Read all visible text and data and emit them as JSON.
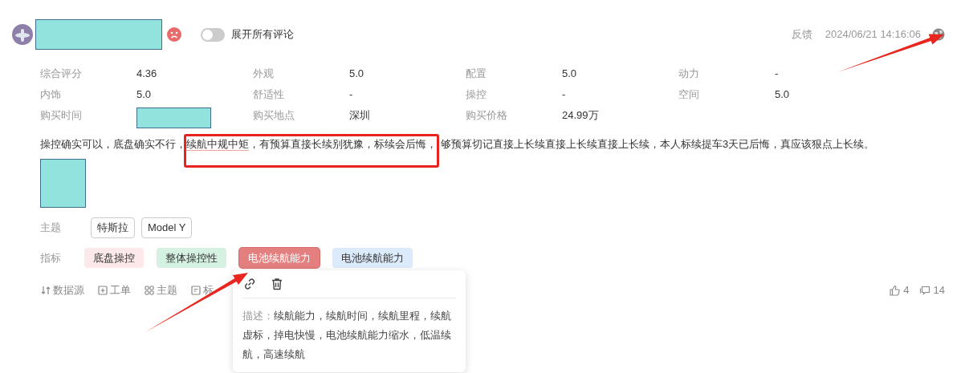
{
  "review": {
    "user": {
      "name_redacted": true
    },
    "sentiment": {
      "kind": "negative"
    },
    "expand_toggle": {
      "label": "展开所有评论",
      "on": false
    },
    "feedback": "反馈",
    "time": "2024/06/21 14:16:06"
  },
  "stats": [
    {
      "label": "综合评分",
      "value": "4.36"
    },
    {
      "label": "外观",
      "value": "5.0"
    },
    {
      "label": "配置",
      "value": "5.0"
    },
    {
      "label": "动力",
      "value": "-"
    },
    {
      "label": "内饰",
      "value": "5.0"
    },
    {
      "label": "舒适性",
      "value": "-"
    },
    {
      "label": "操控",
      "value": "-"
    },
    {
      "label": "空间",
      "value": "5.0"
    },
    {
      "label": "购买时间",
      "redacted": true
    },
    {
      "label": "购买地点",
      "value": "深圳"
    },
    {
      "label": "购买价格",
      "value": "24.99万"
    }
  ],
  "comment": [
    {
      "text": "操控确实可以，底盘确实不行，",
      "kind": "plain"
    },
    {
      "text": "续航中规中矩",
      "kind": "highlighted_boxed"
    },
    {
      "text": "，有预算直接长续别犹豫，标续会后悔，",
      "kind": "boxed"
    },
    {
      "text": "够预算切记直接上长续直接上长续直接上长续，本人标续提车3天已后悔，真应该狠点上长续。",
      "kind": "plain"
    }
  ],
  "images": [
    {
      "redacted": true
    }
  ],
  "topics": {
    "label": "主题",
    "tags": [
      "特斯拉",
      "Model Y"
    ]
  },
  "indicators": {
    "label": "指标",
    "tags": [
      {
        "text": "底盘操控",
        "color": "#fde9e9",
        "selected": false
      },
      {
        "text": "整体操控性",
        "color": "#d4f1e2",
        "selected": false
      },
      {
        "text": "电池续航能力",
        "color": "#e47f7f",
        "selected": true
      },
      {
        "text": "电池续航能力",
        "color": "#dcebfb",
        "selected": false
      }
    ]
  },
  "actions": [
    {
      "kind": "source",
      "label": "数据源"
    },
    {
      "kind": "ticket",
      "label": "工单"
    },
    {
      "kind": "topic",
      "label": "主题"
    },
    {
      "kind": "tag",
      "label": "标"
    }
  ],
  "likes": "4",
  "comments": "14",
  "popover": {
    "label": "描述：",
    "text": "续航能力，续航时间，续航里程，续航虚标，掉电快慢，电池续航能力缩水，低温续航，高速续航"
  },
  "annotations": [
    {
      "kind": "arrow"
    },
    {
      "kind": "arrow"
    }
  ]
}
